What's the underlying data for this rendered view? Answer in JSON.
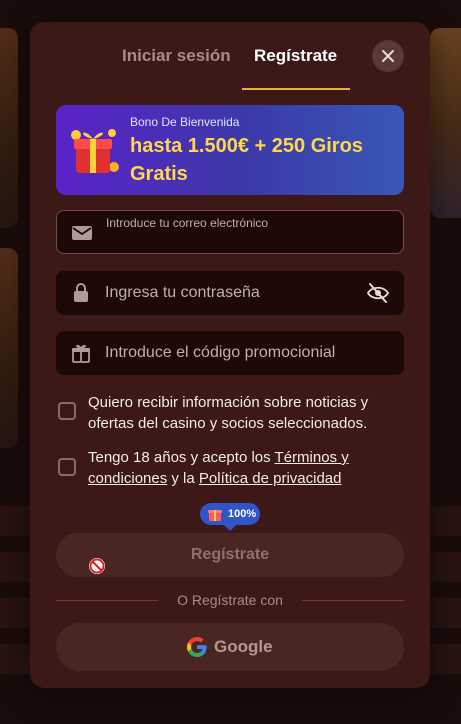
{
  "tabs": {
    "login": "Iniciar sesión",
    "register": "Regístrate"
  },
  "bonus": {
    "kicker": "Bono De Bienvenida",
    "title": "hasta 1.500€ + 250 Giros Gratis"
  },
  "fields": {
    "email_placeholder": "Introduce tu correo electrónico",
    "password_placeholder": "Ingresa tu contraseña",
    "promo_placeholder": "Introduce el código promocionial"
  },
  "consents": {
    "marketing": "Quiero recibir información sobre noticias y ofertas del casino y socios seleccionados.",
    "age_prefix": "Tengo 18 años y acepto los ",
    "terms_link": "Términos y condiciones",
    "age_middle": " y la ",
    "privacy_link": "Política de privacidad"
  },
  "badge": {
    "text": "100%"
  },
  "submit_label": "Regístrate",
  "divider_text": "O Regístrate con",
  "google_label": "Google",
  "colors": {
    "modal_bg": "#3c1816",
    "accent": "#f0a93a",
    "bonus_title": "#ffd84a",
    "badge": "#2f55c8"
  },
  "icons": {
    "close": "close-icon",
    "email": "mail-icon",
    "password": "lock-icon",
    "promo": "gift-icon",
    "visibility": "eye-off-icon",
    "disabled": "no-entry-icon",
    "google": "google-logo-icon"
  }
}
